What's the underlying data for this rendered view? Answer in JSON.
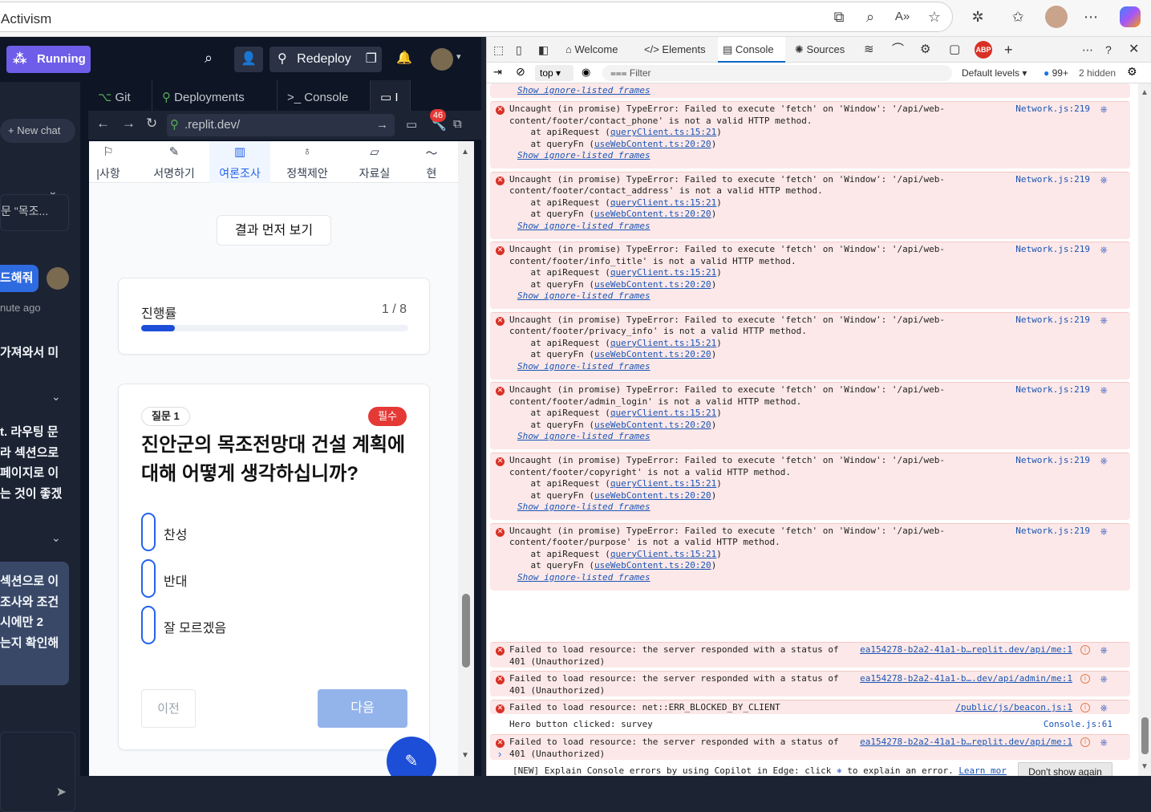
{
  "browser": {
    "tab_title": "Activism"
  },
  "replit": {
    "status": "Running",
    "redeploy": "Redeploy",
    "tabs": [
      "Git",
      "Deployments",
      "Console"
    ],
    "url": ".replit.dev/",
    "notif_count": "46",
    "chat": {
      "new_chat": "+ New chat",
      "item1": "문 \"목조...",
      "msg1": "드해줘",
      "time1": "nute ago",
      "msg2": "가져와서 미",
      "block3": [
        "t. 라우팅 문",
        "라 섹션으로",
        "페이지로 이",
        "는 것이 좋겠"
      ],
      "block4": [
        "섹션으로 이",
        "조사와 조건",
        " 시에만 2",
        "는지 확인해"
      ]
    }
  },
  "site": {
    "nav": [
      "|사항",
      "서명하기",
      "여론조사",
      "정책제안",
      "자료실",
      "현"
    ],
    "nav_active_index": 2,
    "result_first": "결과 먼저 보기",
    "progress_label": "진행률",
    "progress_text": "1 / 8",
    "progress_fraction": 0.125,
    "question_badge": "질문 1",
    "required_badge": "필수",
    "question": "진안군의 목조전망대 건설 계획에 대해 어떻게 생각하십니까?",
    "options": [
      "찬성",
      "반대",
      "잘 모르겠음"
    ],
    "prev": "이전",
    "next": "다음"
  },
  "devtools": {
    "tabs": [
      "Welcome",
      "Elements",
      "Console",
      "Sources"
    ],
    "context": "top",
    "filter_placeholder": "Filter",
    "levels": "Default levels",
    "issues": "99+",
    "hidden": "2 hidden",
    "show_ignore": "Show ignore-listed frames",
    "errors": [
      {
        "path": "content/footer/contact_phone"
      },
      {
        "path": "content/footer/contact_address"
      },
      {
        "path": "content/footer/info_title"
      },
      {
        "path": "content/footer/privacy_info"
      },
      {
        "path": "content/footer/admin_login"
      },
      {
        "path": "content/footer/copyright"
      },
      {
        "path": "content/footer/purpose"
      }
    ],
    "uncaught_prefix": "Uncaught (in promise) TypeError: Failed to execute 'fetch' on 'Window': '/api/web-",
    "uncaught_suffix": "' is not a valid HTTP method.",
    "stack1": "at apiRequest (",
    "stack1_link": "queryClient.ts:15:21",
    "stack2": "at queryFn (",
    "stack2_link": "useWebContent.ts:20:20",
    "network_src": "Network.js:219",
    "res401a_line1": "Failed to load resource: the server responded with a status of",
    "res401a_line2": "401 (Unauthorized)",
    "res401a_src": "ea154278-b2a2-41a1-b…replit.dev/api/me:1",
    "res401b_src": "ea154278-b2a2-41a1-b….dev/api/admin/me:1",
    "blocked": "Failed to load resource: net::ERR_BLOCKED_BY_CLIENT",
    "blocked_src": "/public/js/beacon.js:1",
    "hero": "Hero button clicked: survey",
    "hero_src": "Console.js:61",
    "res401c_src": "ea154278-b2a2-41a1-b…replit.dev/api/me:1",
    "copilot_line": "[NEW] Explain Console errors by using Copilot in Edge: click",
    "copilot_tail": "to explain an error.",
    "learn_more": "Learn mor",
    "learn_more2": "e",
    "dont_show": "Don't show again"
  }
}
